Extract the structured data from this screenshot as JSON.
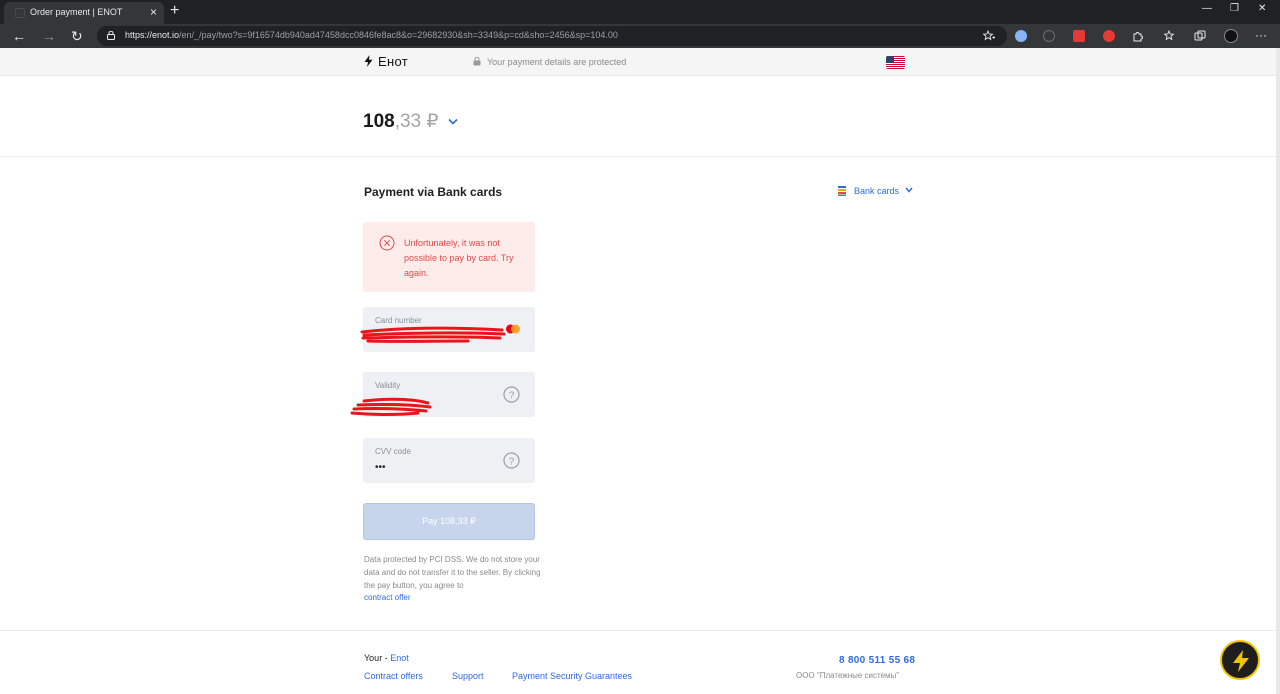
{
  "browser": {
    "tab_title": "Order payment | ENOT",
    "tab_close": "×",
    "new_tab": "+",
    "url_host": "https://enot.io",
    "url_path": "/en/_/pay/two?s=9f16574db940ad47458dcc0846fe8ac8&o=29682930&sh=3349&p=cd&sho=2456&sp=104.00",
    "window_controls": [
      "—",
      "❐",
      "✕"
    ],
    "nav": {
      "back": "←",
      "forward": "→",
      "reload": "↻"
    },
    "menu": "···"
  },
  "header": {
    "brand": "Енот",
    "secure_text": "Your payment details are protected"
  },
  "amount": {
    "whole": "108",
    "fraction": ",33 ₽"
  },
  "payment": {
    "section_title": "Payment via Bank cards",
    "method_label": "Bank cards",
    "error_message": "Unfortunately, it was not possible to pay by card. Try again.",
    "card_number_label": "Card number",
    "validity_label": "Validity",
    "cvv_label": "CVV code",
    "cvv_value": "•••",
    "pay_button": "Pay 108,33 ₽",
    "disclaimer": "Data protected by PCI DSS. We do not store your data and do not transfer it to the seller. By clicking the pay button, you agree to",
    "contract_offer": "contract offer"
  },
  "footer": {
    "your_label": "Your - ",
    "your_brand": "Enot",
    "links": [
      "Contract offers",
      "Support",
      "Payment Security Guarantees"
    ],
    "phone": "8 800 511 55 68",
    "company": "ООО \"Платежные системы\""
  },
  "colors": {
    "accent": "#2d6cdf",
    "error": "#e04b4b",
    "error_bg": "#fdecea",
    "field_bg": "#eef0f4",
    "button_disabled": "#c6d5ec",
    "fab_ring": "#f2c200"
  }
}
